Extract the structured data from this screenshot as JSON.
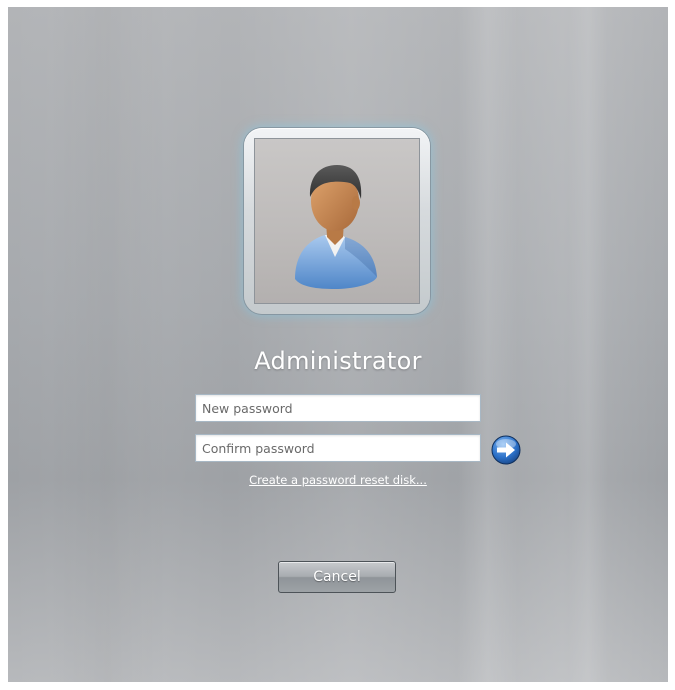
{
  "user": {
    "name": "Administrator",
    "avatar_icon": "user-avatar-icon"
  },
  "form": {
    "new_password_placeholder": "New password",
    "confirm_password_placeholder": "Confirm password",
    "submit_icon": "arrow-right-icon"
  },
  "links": {
    "reset_disk": "Create a password reset disk..."
  },
  "buttons": {
    "cancel_label": "Cancel"
  },
  "colors": {
    "background": "#a9acb0",
    "tile_glow": "#82c8e6",
    "go_button": "#2a6fc7"
  }
}
